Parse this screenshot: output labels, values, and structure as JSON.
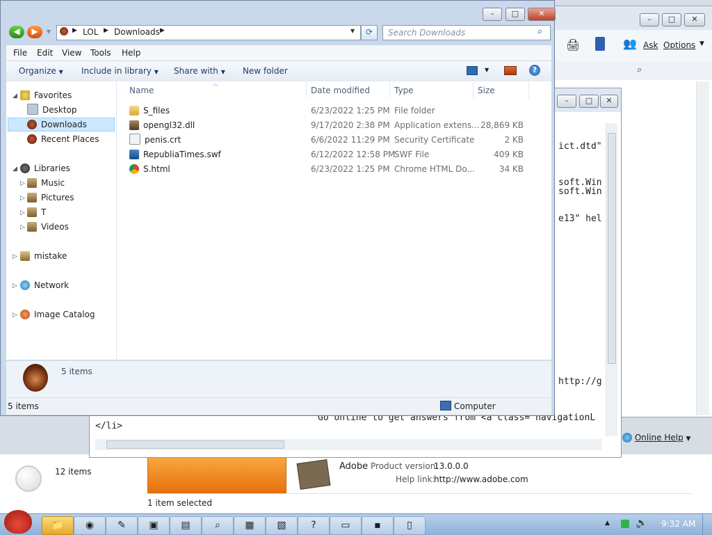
{
  "back_window": {
    "toolbar_ask": "Ask",
    "toolbar_options": "Options",
    "online_help": "Online Help"
  },
  "product_window": {
    "items_count": "12 items",
    "product_name": "Adobe",
    "product_version_label": "Product version:",
    "product_version_value": "13.0.0.0",
    "help_link_label": "Help link:",
    "help_link_value": "http://www.adobe.com",
    "selection_status": "1 item selected"
  },
  "editor": {
    "lines": [
      "ict.dtd\"",
      "soft.Win",
      "soft.Win",
      "e13\" hel",
      "http://g",
      "Go online to get answers from <a class=\"navigationL",
      "</li>"
    ]
  },
  "explorer": {
    "breadcrumb": [
      "LOL",
      "Downloads"
    ],
    "search_placeholder": "Search Downloads",
    "menu": [
      "File",
      "Edit",
      "View",
      "Tools",
      "Help"
    ],
    "commands": [
      "Organize",
      "Include in library",
      "Share with",
      "New folder"
    ],
    "nav": {
      "favorites": "Favorites",
      "desktop": "Desktop",
      "downloads": "Downloads",
      "recent": "Recent Places",
      "libraries": "Libraries",
      "music": "Music",
      "pictures": "Pictures",
      "t": "T",
      "videos": "Videos",
      "mistake": "mistake",
      "network": "Network",
      "image_catalog": "Image Catalog"
    },
    "columns": [
      "Name",
      "Date modified",
      "Type",
      "Size"
    ],
    "files": [
      {
        "name": "S_files",
        "date": "6/23/2022 1:25 PM",
        "type": "File folder",
        "size": ""
      },
      {
        "name": "opengl32.dll",
        "date": "9/17/2020 2:38 PM",
        "type": "Application extens...",
        "size": "28,869 KB"
      },
      {
        "name": "penis.crt",
        "date": "6/6/2022 11:29 PM",
        "type": "Security Certificate",
        "size": "2 KB"
      },
      {
        "name": "RepubliaTimes.swf",
        "date": "6/12/2022 12:58 PM",
        "type": "SWF File",
        "size": "409 KB"
      },
      {
        "name": "S.html",
        "date": "6/23/2022 1:25 PM",
        "type": "Chrome HTML Do...",
        "size": "34 KB"
      }
    ],
    "details_count": "5 items",
    "status_left": "5 items",
    "status_right": "Computer"
  },
  "taskbar": {
    "clock": "9:32 AM"
  },
  "colors": {
    "selection": "#cce8ff",
    "accent": "#1e73be"
  }
}
